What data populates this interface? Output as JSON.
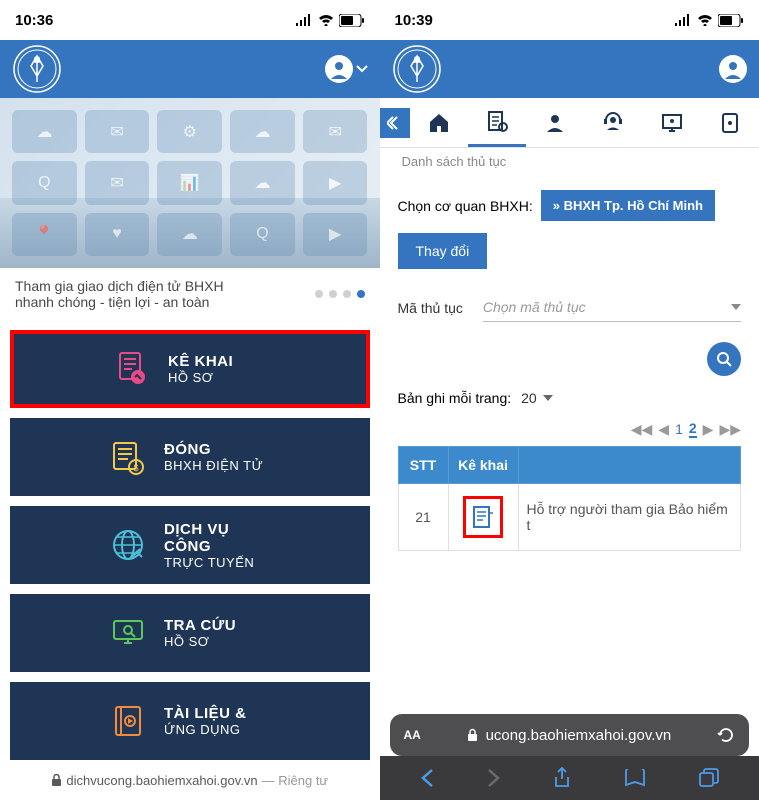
{
  "left": {
    "status_time": "10:36",
    "hero_text1": "Tham gia giao dịch điện tử BHXH",
    "hero_text2": "nhanh chóng - tiện lợi - an toàn",
    "tiles": [
      {
        "title": "KÊ KHAI",
        "sub": "HỒ SƠ",
        "icon": "form-icon",
        "color": "#e94b86"
      },
      {
        "title": "ĐÓNG",
        "sub": "BHXH ĐIỆN TỬ",
        "icon": "money-icon",
        "color": "#f5c84a"
      },
      {
        "title": "DỊCH VỤ CÔNG",
        "sub": "TRỰC TUYẾN",
        "icon": "globe-icon",
        "color": "#4ec0d9"
      },
      {
        "title": "TRA CỨU",
        "sub": "HỒ SƠ",
        "icon": "screen-icon",
        "color": "#5cc85c"
      },
      {
        "title": "TÀI LIỆU &",
        "sub": "ỨNG DỤNG",
        "icon": "book-icon",
        "color": "#f58a3a"
      }
    ],
    "url": "dichvucong.baohiemxahoi.gov.vn",
    "url_priv": "— Riêng tư"
  },
  "right": {
    "status_time": "10:39",
    "crumb": "Danh sách thủ tục",
    "agency_label": "Chọn cơ quan BHXH:",
    "agency_value": "» BHXH Tp. Hồ Chí Minh",
    "change_btn": "Thay đổi",
    "code_label": "Mã thủ tục",
    "code_placeholder": "Chọn mã thủ tục",
    "page_label": "Bản ghi mỗi trang:",
    "page_size": "20",
    "columns": [
      "STT",
      "Kê khai",
      ""
    ],
    "row": {
      "stt": "21",
      "desc": "Hỗ trợ người tham gia Bảo hiểm t"
    },
    "url": "ucong.baohiemxahoi.gov.vn",
    "pager_pages": [
      "1",
      "2"
    ]
  }
}
